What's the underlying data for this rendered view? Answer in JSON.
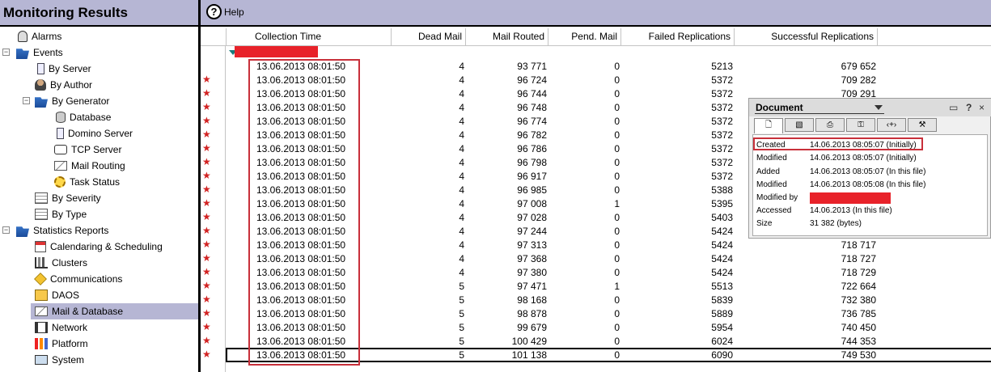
{
  "header": {
    "title": "Monitoring Results",
    "help_label": "Help"
  },
  "tree": {
    "items": [
      {
        "label": "Alarms"
      },
      {
        "label": "Events"
      },
      {
        "label": "By Server"
      },
      {
        "label": "By Author"
      },
      {
        "label": "By Generator"
      },
      {
        "label": "Database"
      },
      {
        "label": "Domino Server"
      },
      {
        "label": "TCP Server"
      },
      {
        "label": "Mail Routing"
      },
      {
        "label": "Task Status"
      },
      {
        "label": "By Severity"
      },
      {
        "label": "By Type"
      },
      {
        "label": "Statistics Reports"
      },
      {
        "label": "Calendaring & Scheduling"
      },
      {
        "label": "Clusters"
      },
      {
        "label": "Communications"
      },
      {
        "label": "DAOS"
      },
      {
        "label": "Mail & Database"
      },
      {
        "label": "Network"
      },
      {
        "label": "Platform"
      },
      {
        "label": "System"
      }
    ],
    "selected": "Mail & Database",
    "selection_color": "#b6b6d4"
  },
  "grid": {
    "columns": [
      "Collection Time",
      "Dead Mail",
      "Mail Routed",
      "Pend. Mail",
      "Failed Replications",
      "Successful Replications"
    ],
    "rows": [
      {
        "time": "13.06.2013 08:01:50",
        "dead": "4",
        "routed": "93 771",
        "pend": "0",
        "failed": "5213",
        "success": "679 652",
        "star": false
      },
      {
        "time": "13.06.2013 08:01:50",
        "dead": "4",
        "routed": "96 724",
        "pend": "0",
        "failed": "5372",
        "success": "709 282",
        "star": true
      },
      {
        "time": "13.06.2013 08:01:50",
        "dead": "4",
        "routed": "96 744",
        "pend": "0",
        "failed": "5372",
        "success": "709 291",
        "star": true
      },
      {
        "time": "13.06.2013 08:01:50",
        "dead": "4",
        "routed": "96 748",
        "pend": "0",
        "failed": "5372",
        "success": "",
        "star": true
      },
      {
        "time": "13.06.2013 08:01:50",
        "dead": "4",
        "routed": "96 774",
        "pend": "0",
        "failed": "5372",
        "success": "",
        "star": true
      },
      {
        "time": "13.06.2013 08:01:50",
        "dead": "4",
        "routed": "96 782",
        "pend": "0",
        "failed": "5372",
        "success": "",
        "star": true
      },
      {
        "time": "13.06.2013 08:01:50",
        "dead": "4",
        "routed": "96 786",
        "pend": "0",
        "failed": "5372",
        "success": "",
        "star": true
      },
      {
        "time": "13.06.2013 08:01:50",
        "dead": "4",
        "routed": "96 798",
        "pend": "0",
        "failed": "5372",
        "success": "",
        "star": true
      },
      {
        "time": "13.06.2013 08:01:50",
        "dead": "4",
        "routed": "96 917",
        "pend": "0",
        "failed": "5372",
        "success": "",
        "star": true
      },
      {
        "time": "13.06.2013 08:01:50",
        "dead": "4",
        "routed": "96 985",
        "pend": "0",
        "failed": "5388",
        "success": "",
        "star": true
      },
      {
        "time": "13.06.2013 08:01:50",
        "dead": "4",
        "routed": "97 008",
        "pend": "1",
        "failed": "5395",
        "success": "",
        "star": true
      },
      {
        "time": "13.06.2013 08:01:50",
        "dead": "4",
        "routed": "97 028",
        "pend": "0",
        "failed": "5403",
        "success": "",
        "star": true
      },
      {
        "time": "13.06.2013 08:01:50",
        "dead": "4",
        "routed": "97 244",
        "pend": "0",
        "failed": "5424",
        "success": "",
        "star": true
      },
      {
        "time": "13.06.2013 08:01:50",
        "dead": "4",
        "routed": "97 313",
        "pend": "0",
        "failed": "5424",
        "success": "718 717",
        "star": true
      },
      {
        "time": "13.06.2013 08:01:50",
        "dead": "4",
        "routed": "97 368",
        "pend": "0",
        "failed": "5424",
        "success": "718 727",
        "star": true
      },
      {
        "time": "13.06.2013 08:01:50",
        "dead": "4",
        "routed": "97 380",
        "pend": "0",
        "failed": "5424",
        "success": "718 729",
        "star": true
      },
      {
        "time": "13.06.2013 08:01:50",
        "dead": "5",
        "routed": "97 471",
        "pend": "1",
        "failed": "5513",
        "success": "722 664",
        "star": true
      },
      {
        "time": "13.06.2013 08:01:50",
        "dead": "5",
        "routed": "98 168",
        "pend": "0",
        "failed": "5839",
        "success": "732 380",
        "star": true
      },
      {
        "time": "13.06.2013 08:01:50",
        "dead": "5",
        "routed": "98 878",
        "pend": "0",
        "failed": "5889",
        "success": "736 785",
        "star": true
      },
      {
        "time": "13.06.2013 08:01:50",
        "dead": "5",
        "routed": "99 679",
        "pend": "0",
        "failed": "5954",
        "success": "740 450",
        "star": true
      },
      {
        "time": "13.06.2013 08:01:50",
        "dead": "5",
        "routed": "100 429",
        "pend": "0",
        "failed": "6024",
        "success": "744 353",
        "star": true
      },
      {
        "time": "13.06.2013 08:01:50",
        "dead": "5",
        "routed": "101 138",
        "pend": "0",
        "failed": "6090",
        "success": "749 530",
        "star": true
      }
    ],
    "star_glyph": "★",
    "star_color": "#d22222",
    "highlight_color": "#c8303a",
    "redaction_color": "#e8222a"
  },
  "document_panel": {
    "title": "Document",
    "controls": [
      "▭",
      "?",
      "×"
    ],
    "tabs": [
      "🗋",
      "▧",
      "⎙",
      "⚿",
      "‹+›",
      "⚒"
    ],
    "properties": [
      {
        "key": "Created",
        "value": "14.06.2013 08:05:07 (Initially)"
      },
      {
        "key": "Modified",
        "value": "14.06.2013 08:05:07 (Initially)"
      },
      {
        "key": "Added",
        "value": "14.06.2013 08:05:07 (In this file)"
      },
      {
        "key": "Modified",
        "value": "14.06.2013 08:05:08 (In this file)"
      },
      {
        "key": "Modified by",
        "value": ""
      },
      {
        "key": "Accessed",
        "value": "14.06.2013 (In this file)"
      },
      {
        "key": "Size",
        "value": "31 382 (bytes)"
      }
    ]
  }
}
